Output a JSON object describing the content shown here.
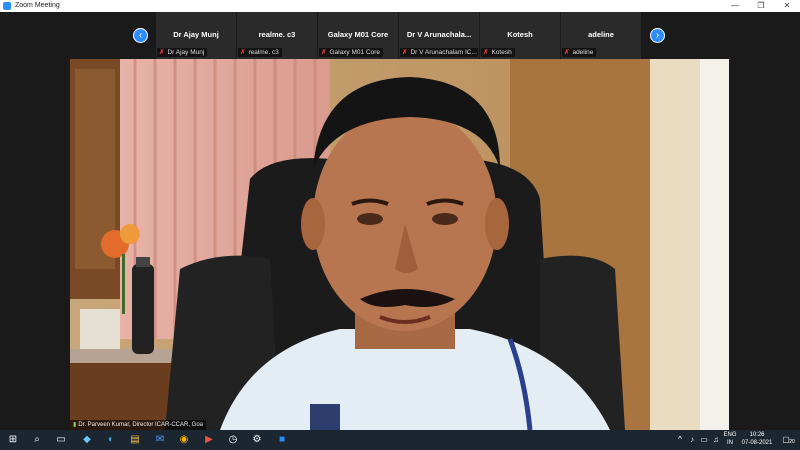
{
  "window": {
    "title": "Zoom Meeting"
  },
  "titlebar_controls": {
    "minimize": "—",
    "maximize": "❐",
    "close": "✕"
  },
  "nav": {
    "prev": "‹",
    "next": "›"
  },
  "participants": [
    {
      "name": "Dr Ajay Munj",
      "tag": "Dr Ajay Munj"
    },
    {
      "name": "realme. c3",
      "tag": "realme. c3"
    },
    {
      "name": "Galaxy M01 Core",
      "tag": "Galaxy M01 Core"
    },
    {
      "name": "Dr V Arunachala...",
      "tag": "Dr V Arunachalam IC..."
    },
    {
      "name": "Kotesh",
      "tag": "Kotesh"
    },
    {
      "name": "adeline",
      "tag": "adeline"
    }
  ],
  "active_speaker": {
    "label": "Dr. Parveen Kumar, Director ICAR-CCAR, Goa"
  },
  "taskbar": {
    "icons": [
      "windows-start-icon",
      "search-icon",
      "task-view-icon",
      "pin-icon",
      "edge-icon",
      "mail-icon",
      "file-explorer-icon",
      "chrome-icon",
      "media-icon",
      "clock-app-icon",
      "settings-icon",
      "zoom-icon"
    ],
    "lang_top": "ENG",
    "lang_bottom": "IN",
    "time": "10:26",
    "date": "07-08-2021",
    "notification_count": "20"
  },
  "colors": {
    "accent": "#2d8cff",
    "muted": "#e23b3b",
    "taskbar": "#1c2631"
  }
}
